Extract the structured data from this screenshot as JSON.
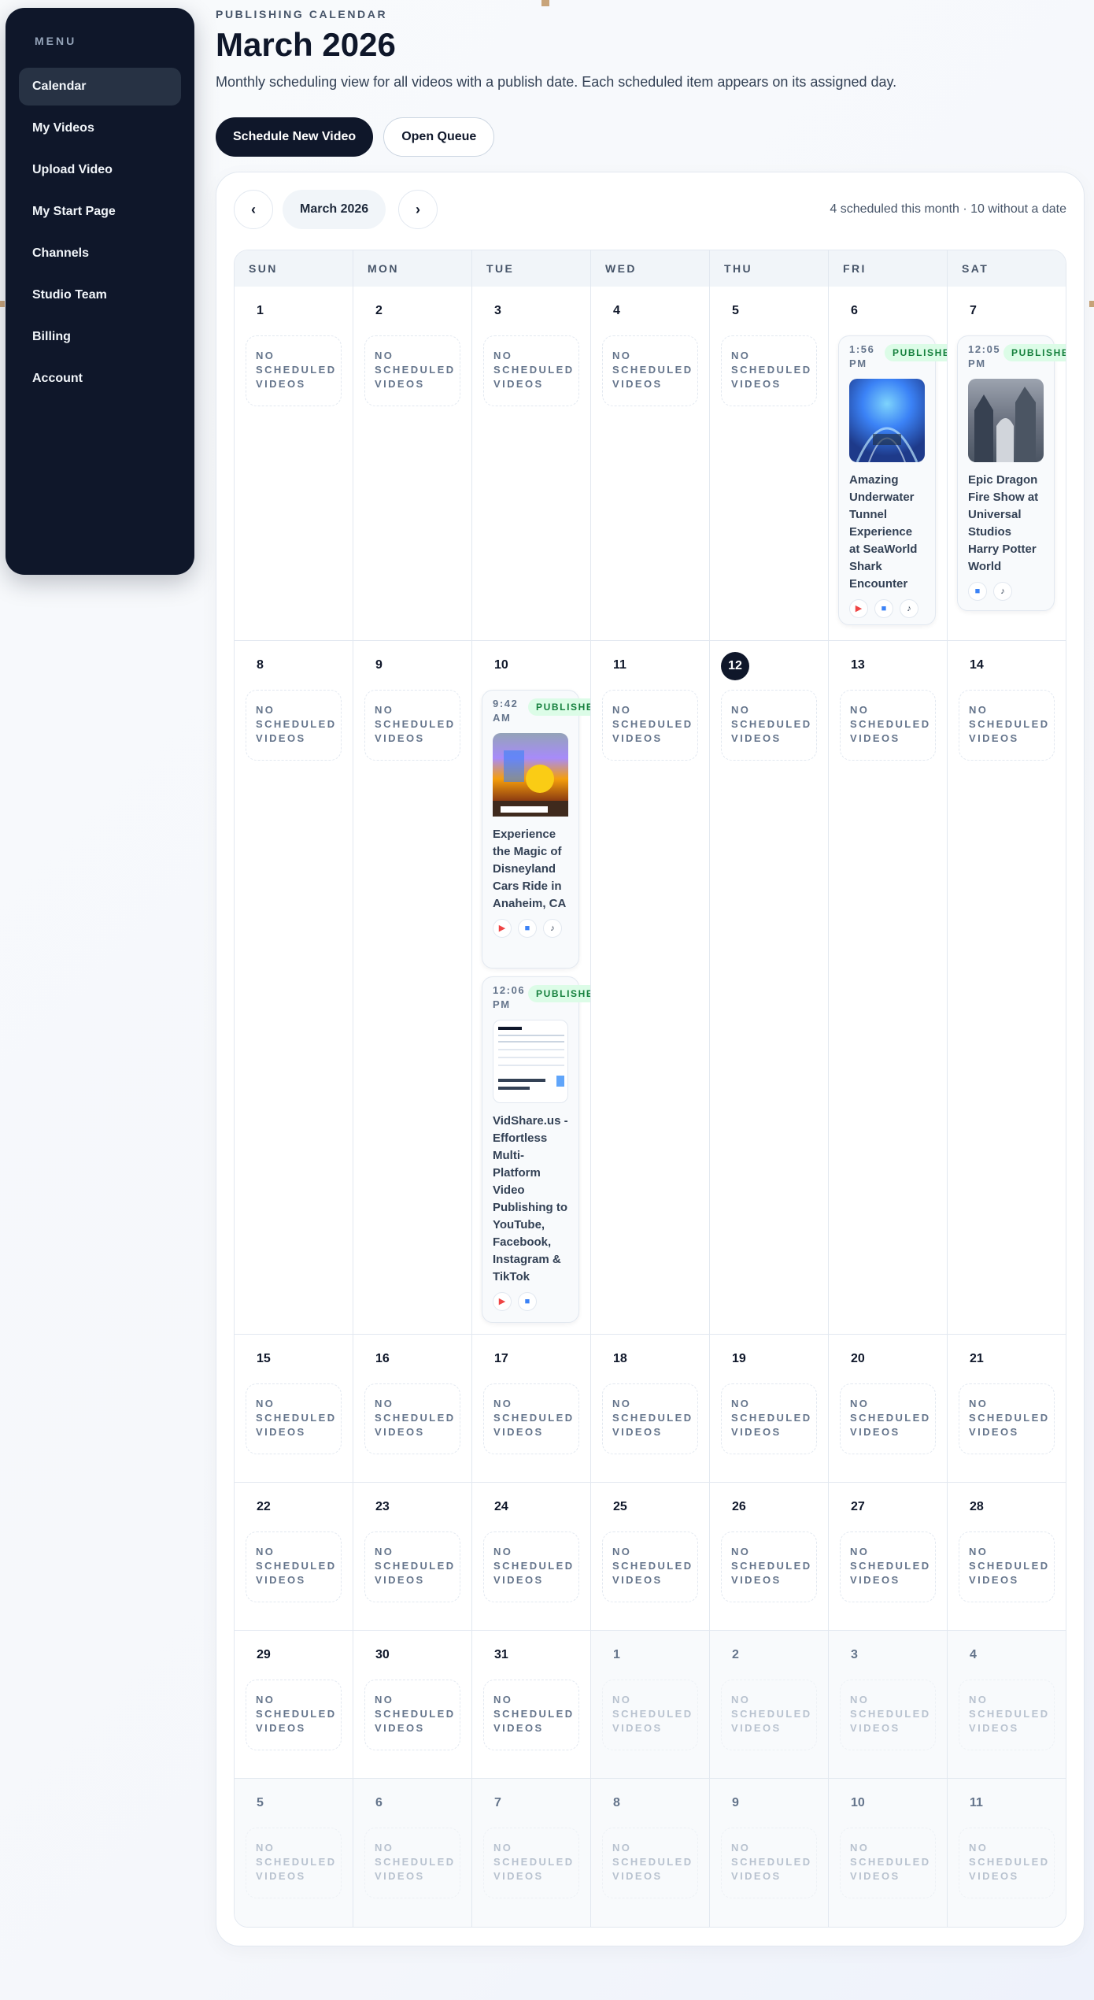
{
  "sidebar": {
    "menu_label": "MENU",
    "items": [
      {
        "label": "Calendar",
        "active": true
      },
      {
        "label": "My Videos"
      },
      {
        "label": "Upload Video"
      },
      {
        "label": "My Start Page"
      },
      {
        "label": "Channels"
      },
      {
        "label": "Studio Team"
      },
      {
        "label": "Billing"
      },
      {
        "label": "Account"
      }
    ]
  },
  "header": {
    "eyebrow": "PUBLISHING CALENDAR",
    "title": "March 2026",
    "subtitle": "Monthly scheduling view for all videos with a publish date. Each scheduled item appears on its assigned day."
  },
  "actions": {
    "primary": "Schedule New Video",
    "secondary": "Open Queue"
  },
  "calendar": {
    "prev_icon": "‹",
    "next_icon": "›",
    "month_label": "March 2026",
    "summary": "4 scheduled this month · 10 without a date",
    "empty_label": "NO SCHEDULED VIDEOS",
    "weekdays": [
      "SUN",
      "MON",
      "TUE",
      "WED",
      "THU",
      "FRI",
      "SAT"
    ],
    "today": 12,
    "weeks": [
      [
        {
          "d": "1"
        },
        {
          "d": "2"
        },
        {
          "d": "3"
        },
        {
          "d": "4"
        },
        {
          "d": "5"
        },
        {
          "d": "6",
          "events": [
            0
          ]
        },
        {
          "d": "7",
          "events": [
            1
          ]
        }
      ],
      [
        {
          "d": "8"
        },
        {
          "d": "9"
        },
        {
          "d": "10",
          "events": [
            2,
            3
          ]
        },
        {
          "d": "11"
        },
        {
          "d": "12",
          "today": true
        },
        {
          "d": "13"
        },
        {
          "d": "14"
        }
      ],
      [
        {
          "d": "15"
        },
        {
          "d": "16"
        },
        {
          "d": "17"
        },
        {
          "d": "18"
        },
        {
          "d": "19"
        },
        {
          "d": "20"
        },
        {
          "d": "21"
        }
      ],
      [
        {
          "d": "22"
        },
        {
          "d": "23"
        },
        {
          "d": "24"
        },
        {
          "d": "25"
        },
        {
          "d": "26"
        },
        {
          "d": "27"
        },
        {
          "d": "28"
        }
      ],
      [
        {
          "d": "29"
        },
        {
          "d": "30"
        },
        {
          "d": "31"
        },
        {
          "d": "1",
          "outside": true
        },
        {
          "d": "2",
          "outside": true
        },
        {
          "d": "3",
          "outside": true
        },
        {
          "d": "4",
          "outside": true
        }
      ],
      [
        {
          "d": "5",
          "outside": true
        },
        {
          "d": "6",
          "outside": true
        },
        {
          "d": "7",
          "outside": true
        },
        {
          "d": "8",
          "outside": true
        },
        {
          "d": "9",
          "outside": true
        },
        {
          "d": "10",
          "outside": true
        },
        {
          "d": "11",
          "outside": true
        }
      ]
    ],
    "events": [
      {
        "time": "1:56 PM",
        "status": "PUBLISHED",
        "title": "Amazing Underwater Tunnel Experience at SeaWorld Shark Encounter",
        "thumb": "underwater",
        "platforms": [
          "youtube",
          "facebook",
          "tiktok"
        ]
      },
      {
        "time": "12:05 PM",
        "status": "PUBLISHED",
        "title": "Epic Dragon Fire Show at Universal Studios Harry Potter World",
        "thumb": "dragon",
        "platforms": [
          "facebook",
          "tiktok"
        ]
      },
      {
        "time": "9:42 AM",
        "status": "PUBLISHED",
        "title": "Experience the Magic of Disneyland Cars Ride in Anaheim, CA",
        "thumb": "cars",
        "platforms": [
          "youtube",
          "facebook",
          "tiktok"
        ]
      },
      {
        "time": "12:06 PM",
        "status": "PUBLISHED",
        "title": "VidShare.us - Effortless Multi-Platform Video Publishing to YouTube, Facebook, Instagram & TikTok",
        "thumb": "vidshare",
        "platforms": [
          "youtube",
          "facebook"
        ]
      }
    ],
    "platform_icons": {
      "youtube": "▶",
      "facebook": "■",
      "tiktok": "♪"
    }
  }
}
